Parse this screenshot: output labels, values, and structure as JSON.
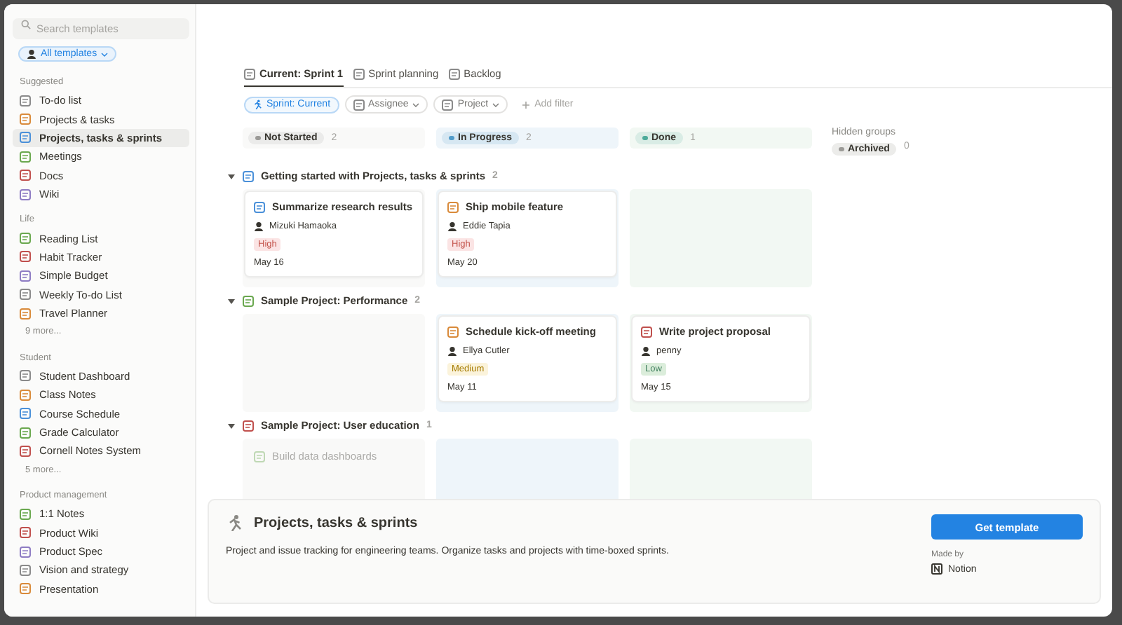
{
  "sidebar": {
    "search": {
      "placeholder": "Search templates"
    },
    "filter": "All templates",
    "sections": [
      {
        "title": "Suggested",
        "items": [
          {
            "label": "To-do list",
            "selected": false
          },
          {
            "label": "Projects & tasks",
            "selected": false
          },
          {
            "label": "Projects, tasks & sprints",
            "selected": true
          },
          {
            "label": "Meetings",
            "selected": false
          },
          {
            "label": "Docs",
            "selected": false
          },
          {
            "label": "Wiki",
            "selected": false
          }
        ]
      },
      {
        "title": "Life",
        "items": [
          {
            "label": "Reading List",
            "selected": false
          },
          {
            "label": "Habit Tracker",
            "selected": false
          },
          {
            "label": "Simple Budget",
            "selected": false
          },
          {
            "label": "Weekly To-do List",
            "selected": false
          },
          {
            "label": "Travel Planner",
            "selected": false
          }
        ],
        "more": "9 more..."
      },
      {
        "title": "Student",
        "items": [
          {
            "label": "Student Dashboard",
            "selected": false
          },
          {
            "label": "Class Notes",
            "selected": false
          },
          {
            "label": "Course Schedule",
            "selected": false
          },
          {
            "label": "Grade Calculator",
            "selected": false
          },
          {
            "label": "Cornell Notes System",
            "selected": false
          }
        ],
        "more": "5 more..."
      },
      {
        "title": "Product management",
        "items": [
          {
            "label": "1:1 Notes",
            "selected": false
          },
          {
            "label": "Product Wiki",
            "selected": false
          },
          {
            "label": "Product Spec",
            "selected": false
          },
          {
            "label": "Vision and strategy",
            "selected": false
          },
          {
            "label": "Presentation",
            "selected": false
          }
        ]
      }
    ]
  },
  "tabs": [
    {
      "label": "Current: Sprint 1",
      "selected": true
    },
    {
      "label": "Sprint planning",
      "selected": false
    },
    {
      "label": "Backlog",
      "selected": false
    }
  ],
  "filters": [
    {
      "label": "Sprint: Current",
      "kind": "active"
    },
    {
      "label": "Assignee",
      "kind": "dropdown"
    },
    {
      "label": "Project",
      "kind": "dropdown"
    },
    {
      "label": "Add filter",
      "kind": "add"
    }
  ],
  "columns": [
    {
      "label": "Not Started",
      "count": "2",
      "color": "#9b9a97"
    },
    {
      "label": "In Progress",
      "count": "2",
      "color": "#529cca"
    },
    {
      "label": "Done",
      "count": "1",
      "color": "#4dab9a"
    }
  ],
  "hidden_groups": {
    "title": "Hidden groups",
    "groups": [
      {
        "label": "Archived",
        "count": "0"
      }
    ]
  },
  "groups": [
    {
      "title": "Getting started with Projects, tasks & sprints",
      "count": "2",
      "expanded": true,
      "cells": [
        [
          {
            "title": "Summarize research results",
            "assignee": "Mizuki Hamaoka",
            "priority": {
              "label": "High",
              "kind": "high"
            },
            "date": "May 16"
          }
        ],
        [
          {
            "title": "Ship mobile feature",
            "assignee": "Eddie Tapia",
            "priority": {
              "label": "High",
              "kind": "high"
            },
            "date": "May 20"
          }
        ],
        []
      ]
    },
    {
      "title": "Sample Project: Performance",
      "count": "2",
      "expanded": true,
      "cells": [
        [],
        [
          {
            "title": "Schedule kick-off meeting",
            "assignee": "Ellya Cutler",
            "priority": {
              "label": "Medium",
              "kind": "medium"
            },
            "date": "May 11"
          }
        ],
        [
          {
            "title": "Write project proposal",
            "assignee": "penny",
            "priority": {
              "label": "Low",
              "kind": "low"
            },
            "date": "May 15"
          }
        ]
      ]
    },
    {
      "title": "Sample Project: User education",
      "count": "1",
      "expanded": true,
      "cells": [
        [
          {
            "title": "Build data dashboards",
            "faded": true
          }
        ],
        [],
        []
      ]
    }
  ],
  "footer": {
    "title": "Projects, tasks & sprints",
    "description": "Project and issue tracking for engineering teams. Organize tasks and projects with time-boxed sprints.",
    "button": "Get template",
    "made_by_label": "Made by",
    "author": "Notion"
  }
}
